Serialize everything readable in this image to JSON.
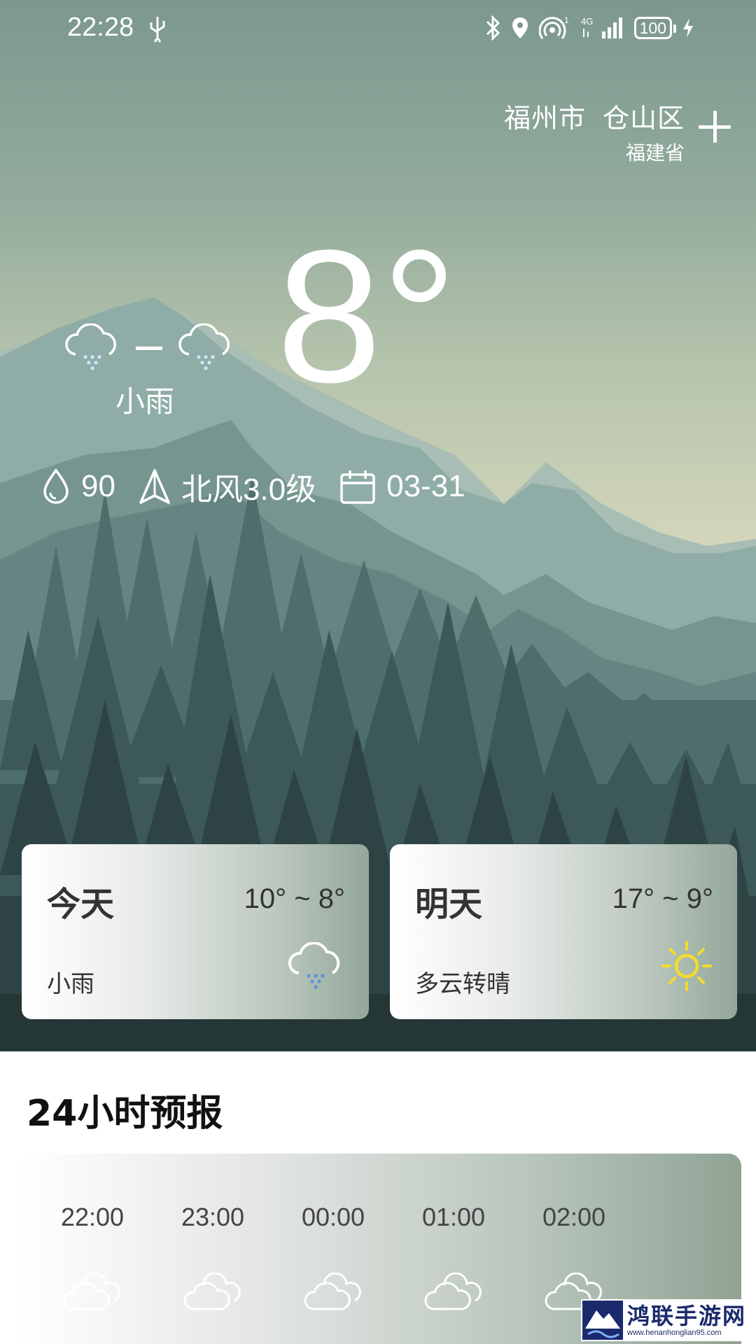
{
  "status_bar": {
    "time": "22:28",
    "signal_superscript": "1",
    "network": "4G",
    "battery": "100"
  },
  "location": {
    "city": "福州市",
    "district": "仓山区",
    "province": "福建省"
  },
  "current": {
    "temperature": "8°",
    "condition": "小雨",
    "condition_icons": [
      "light-rain-icon",
      "light-rain-icon"
    ],
    "humidity": "90",
    "wind": "北风3.0级",
    "date": "03-31"
  },
  "forecast_cards": [
    {
      "day": "今天",
      "range": "10° ~  8°",
      "condition": "小雨",
      "icon": "light-rain-icon"
    },
    {
      "day": "明天",
      "range": "17° ~  9°",
      "condition": "多云转晴",
      "icon": "sun-icon"
    }
  ],
  "hourly": {
    "title": "24小时预报",
    "hours": [
      {
        "time": "22:00",
        "icon": "cloudy-icon"
      },
      {
        "time": "23:00",
        "icon": "cloudy-icon"
      },
      {
        "time": "00:00",
        "icon": "cloudy-icon"
      },
      {
        "time": "01:00",
        "icon": "cloudy-icon"
      },
      {
        "time": "02:00",
        "icon": "cloudy-icon"
      }
    ]
  },
  "watermark": {
    "title": "鸿联手游网",
    "url": "www.henanhonglian95.com"
  },
  "colors": {
    "hero_sky": "#d3d6bb",
    "mountain_far": "#8fada6",
    "forest_dark": "#2e4444",
    "card_text": "#333333",
    "sun": "#f5dc2a"
  }
}
